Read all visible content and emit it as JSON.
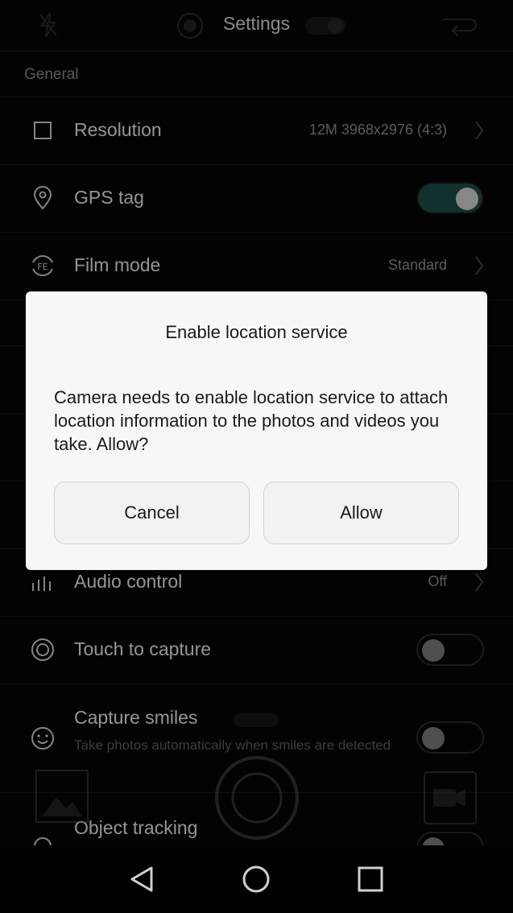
{
  "header": {
    "title": "Settings"
  },
  "section": {
    "general": "General"
  },
  "rows": {
    "resolution": {
      "label": "Resolution",
      "value": "12M 3968x2976 (4:3)"
    },
    "gps": {
      "label": "GPS tag",
      "toggle": "on"
    },
    "film": {
      "label": "Film mode",
      "value": "Standard"
    },
    "audio": {
      "label": "Audio control",
      "value": "Off"
    },
    "touch": {
      "label": "Touch to capture",
      "toggle": "off"
    },
    "smiles": {
      "label": "Capture smiles",
      "sublabel": "Take photos automatically when smiles are detected",
      "toggle": "off"
    },
    "tracking": {
      "label": "Object tracking"
    }
  },
  "dialog": {
    "title": "Enable location service",
    "message": "Camera needs to enable location service to attach location information to the photos and videos you take. Allow?",
    "cancel": "Cancel",
    "allow": "Allow"
  },
  "icons": {
    "film_icon_text": "FE"
  },
  "colors": {
    "toggle_on": "#1c4a48",
    "dialog_bg": "#f7f7f7"
  }
}
